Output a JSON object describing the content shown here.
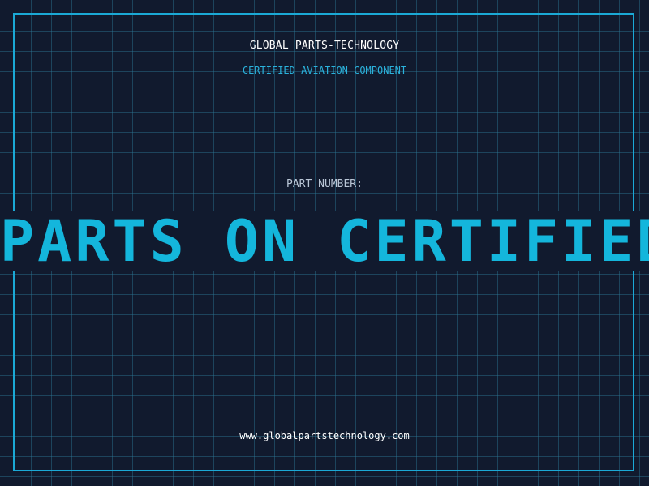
{
  "header": {
    "company": "GLOBAL PARTS-TECHNOLOGY",
    "subtitle": "CERTIFIED AVIATION COMPONENT"
  },
  "part": {
    "label": "PART NUMBER:",
    "value": "PARTS ON CERTIFIED"
  },
  "footer": {
    "url": "www.globalpartstechnology.com"
  },
  "colors": {
    "background": "#111a2e",
    "grid": "#2d7896",
    "accent": "#1ba9d6",
    "text": "#ffffff"
  }
}
